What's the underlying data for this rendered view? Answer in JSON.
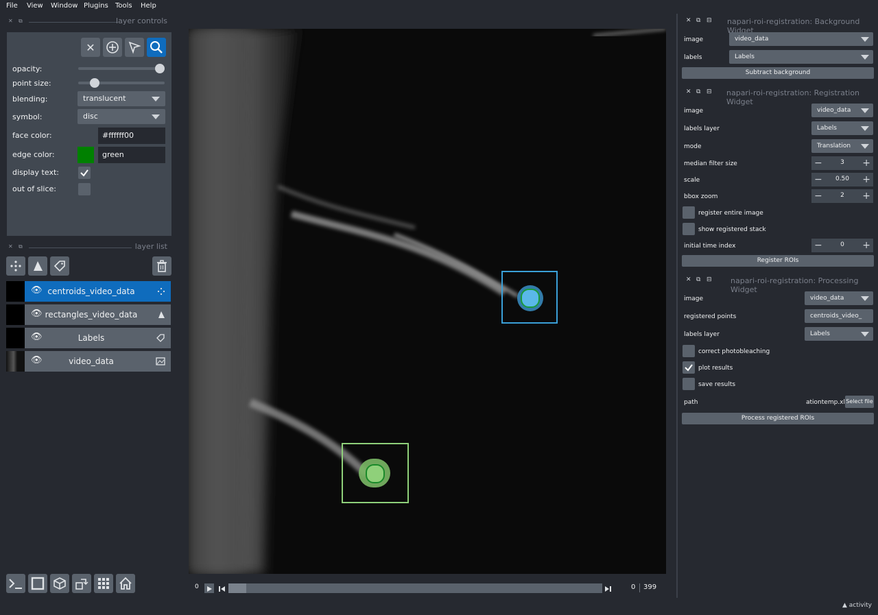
{
  "menu": [
    "File",
    "View",
    "Window",
    "Plugins",
    "Tools",
    "Help"
  ],
  "layer_controls": {
    "title": "layer controls",
    "opacity_label": "opacity:",
    "opacity_value": 1.0,
    "point_size_label": "point size:",
    "point_size_value": 0.15,
    "blending_label": "blending:",
    "blending_value": "translucent",
    "symbol_label": "symbol:",
    "symbol_value": "disc",
    "face_color_label": "face color:",
    "face_color_value": "#ffffff00",
    "edge_color_label": "edge color:",
    "edge_color_value": "green",
    "edge_color_swatch": "#008000",
    "display_text_label": "display text:",
    "display_text_checked": true,
    "out_of_slice_label": "out of slice:",
    "out_of_slice_checked": false
  },
  "layer_list": {
    "title": "layer list",
    "layers": [
      {
        "name": "centroids_video_data",
        "icon": "points-icon",
        "selected": true
      },
      {
        "name": "rectangles_video_data",
        "icon": "shapes-icon",
        "selected": false
      },
      {
        "name": "Labels",
        "icon": "labels-icon",
        "selected": false
      },
      {
        "name": "video_data",
        "icon": "image-icon",
        "selected": false
      }
    ]
  },
  "slider": {
    "start": "0",
    "current": "0",
    "max": "399"
  },
  "background_widget": {
    "title": "napari-roi-registration: Background Widget",
    "image_label": "image",
    "image_value": "video_data",
    "labels_label": "labels",
    "labels_value": "Labels",
    "button": "Subtract background"
  },
  "registration_widget": {
    "title": "napari-roi-registration: Registration Widget",
    "image_label": "image",
    "image_value": "video_data",
    "labels_layer_label": "labels layer",
    "labels_layer_value": "Labels",
    "mode_label": "mode",
    "mode_value": "Translation",
    "median_label": "median filter size",
    "median_value": "3",
    "scale_label": "scale",
    "scale_value": "0.50",
    "bbox_label": "bbox zoom",
    "bbox_value": "2",
    "register_entire_label": "register entire image",
    "show_registered_label": "show registered stack",
    "initial_time_label": "initial time index",
    "initial_time_value": "0",
    "button": "Register ROIs"
  },
  "processing_widget": {
    "title": "napari-roi-registration: Processing Widget",
    "image_label": "image",
    "image_value": "video_data",
    "registered_points_label": "registered points",
    "registered_points_value": "centroids_video_",
    "labels_layer_label": "labels layer",
    "labels_layer_value": "Labels",
    "photobleach_label": "correct photobleaching",
    "plot_results_label": "plot results",
    "save_results_label": "save results",
    "path_label": "path",
    "path_value": "ationtemp.xls",
    "select_file": "Select file",
    "button": "Process registered ROIs"
  },
  "activity": "activity",
  "colors": {
    "accent": "#0f6cbd",
    "roi_blue": "#3aa0d8",
    "roi_green": "#8fd07a"
  }
}
